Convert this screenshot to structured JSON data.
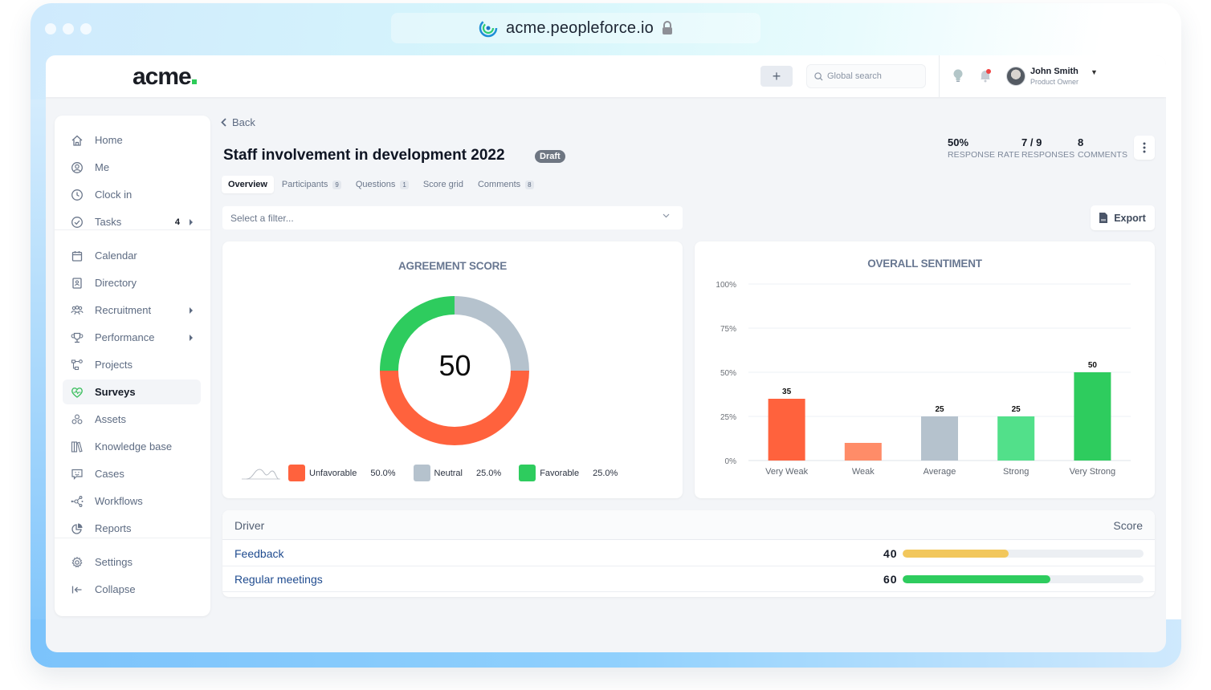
{
  "browser": {
    "url": "acme.peopleforce.io"
  },
  "topbar": {
    "logo": "acme",
    "add_label": "+",
    "search_placeholder": "Global search",
    "user": {
      "name": "John Smith",
      "role": "Product Owner"
    }
  },
  "sidebar": {
    "items": [
      {
        "label": "Home",
        "icon": "home-icon"
      },
      {
        "label": "Me",
        "icon": "user-circle-icon"
      },
      {
        "label": "Clock in",
        "icon": "clock-icon"
      },
      {
        "label": "Tasks",
        "icon": "check-circle-icon",
        "badge": "4",
        "submenu": true
      },
      {
        "label": "Calendar",
        "icon": "calendar-icon"
      },
      {
        "label": "Directory",
        "icon": "directory-icon"
      },
      {
        "label": "Recruitment",
        "icon": "people-icon",
        "submenu": true
      },
      {
        "label": "Performance",
        "icon": "trophy-icon",
        "submenu": true
      },
      {
        "label": "Projects",
        "icon": "projects-icon"
      },
      {
        "label": "Surveys",
        "icon": "heart-pulse-icon",
        "active": true
      },
      {
        "label": "Assets",
        "icon": "assets-icon"
      },
      {
        "label": "Knowledge base",
        "icon": "books-icon"
      },
      {
        "label": "Cases",
        "icon": "chat-smile-icon"
      },
      {
        "label": "Workflows",
        "icon": "workflow-icon"
      },
      {
        "label": "Reports",
        "icon": "pie-chart-icon"
      },
      {
        "label": "Settings",
        "icon": "gear-icon"
      },
      {
        "label": "Collapse",
        "icon": "collapse-icon"
      }
    ]
  },
  "page": {
    "back_label": "Back",
    "title": "Staff involvement in development 2022",
    "status": "Draft",
    "tabs": [
      {
        "label": "Overview",
        "active": true
      },
      {
        "label": "Participants",
        "count": "9"
      },
      {
        "label": "Questions",
        "count": "1"
      },
      {
        "label": "Score grid"
      },
      {
        "label": "Comments",
        "count": "8"
      }
    ],
    "stats": [
      {
        "value": "50%",
        "label": "RESPONSE RATE"
      },
      {
        "value": "7 / 9",
        "label": "RESPONSES"
      },
      {
        "value": "8",
        "label": "COMMENTS"
      }
    ],
    "filter_placeholder": "Select a filter...",
    "export_label": "Export"
  },
  "colors": {
    "unfavorable": "#ff623d",
    "neutral": "#b5c2cd",
    "favorable": "#2ecc5e",
    "weak": "#ff8c68",
    "strong": "#52e08a",
    "score_yellow": "#f2c75c",
    "score_green": "#2ecc5e"
  },
  "agreement": {
    "title": "AGREEMENT SCORE",
    "score": "50",
    "legend": [
      {
        "label": "Unfavorable",
        "pct": "50.0%"
      },
      {
        "label": "Neutral",
        "pct": "25.0%"
      },
      {
        "label": "Favorable",
        "pct": "25.0%"
      }
    ]
  },
  "chart_data": [
    {
      "type": "pie",
      "title": "AGREEMENT SCORE",
      "center_label": "50",
      "categories": [
        "Unfavorable",
        "Neutral",
        "Favorable"
      ],
      "values": [
        50.0,
        25.0,
        25.0
      ],
      "legend": "bottom"
    },
    {
      "type": "bar",
      "title": "OVERALL SENTIMENT",
      "categories": [
        "Very Weak",
        "Weak",
        "Average",
        "Strong",
        "Very Strong"
      ],
      "values": [
        35,
        10,
        25,
        25,
        50
      ],
      "data_labels": [
        "35",
        "",
        "25",
        "25",
        "50"
      ],
      "yticks": [
        "0%",
        "25%",
        "50%",
        "75%",
        "100%"
      ],
      "ylim": [
        0,
        100
      ],
      "xlabel": "",
      "ylabel": "",
      "grid": true
    }
  ],
  "drivers": {
    "header_driver": "Driver",
    "header_score": "Score",
    "rows": [
      {
        "name": "Feedback",
        "score": "40",
        "value": 40
      },
      {
        "name": "Regular meetings",
        "score": "60",
        "value": 60
      }
    ]
  }
}
